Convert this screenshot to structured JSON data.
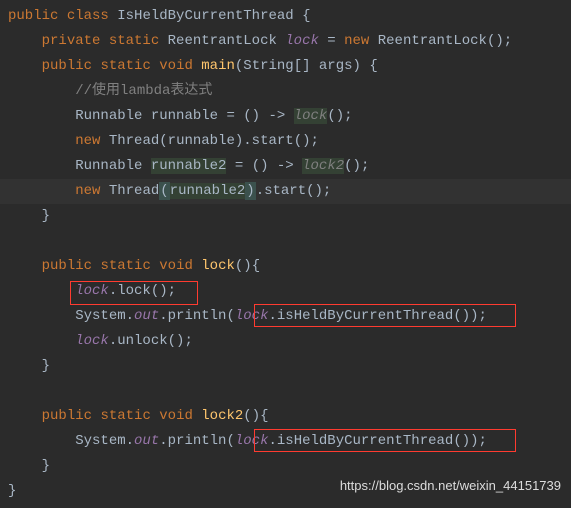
{
  "code": {
    "class_decl_1": "public",
    "class_decl_2": "class",
    "class_name": "IsHeldByCurrentThread",
    "lbrace": "{",
    "rbrace": "}",
    "field_mod1": "private",
    "field_mod2": "static",
    "field_type": "ReentrantLock",
    "field_name": "lock",
    "field_eq": "=",
    "field_new": "new",
    "field_ctor": "ReentrantLock()",
    "semi": ";",
    "main_mod1": "public",
    "main_mod2": "static",
    "main_ret": "void",
    "main_name": "main",
    "main_params": "(String[] args)",
    "comment1": "//使用lambda表达式",
    "runnable_type": "Runnable",
    "runnable1": "runnable",
    "arrow": "() ->",
    "lock_ref": "lock",
    "call_tail": "()",
    "new_kw": "new",
    "thread_type": "Thread",
    "runnable1_arg": "(runnable)",
    "start_call": ".start()",
    "runnable2": "runnable2",
    "lock2_ref": "lock2",
    "runnable2_arg_open": "(",
    "runnable2_arg_name": "runnable2",
    "runnable2_arg_close": ")",
    "lock_method": "lock",
    "lock_body1_obj": "lock",
    "lock_body1_call": ".lock();",
    "sout_sys": "System.",
    "sout_out": "out",
    "sout_print": ".println(",
    "isHeld": ".isHeldByCurrentThread()",
    "close_paren_semi": ");",
    "unlock_call": ".unlock();",
    "lock2_method": "lock2"
  },
  "watermark": "https://blog.csdn.net/weixin_44151739"
}
